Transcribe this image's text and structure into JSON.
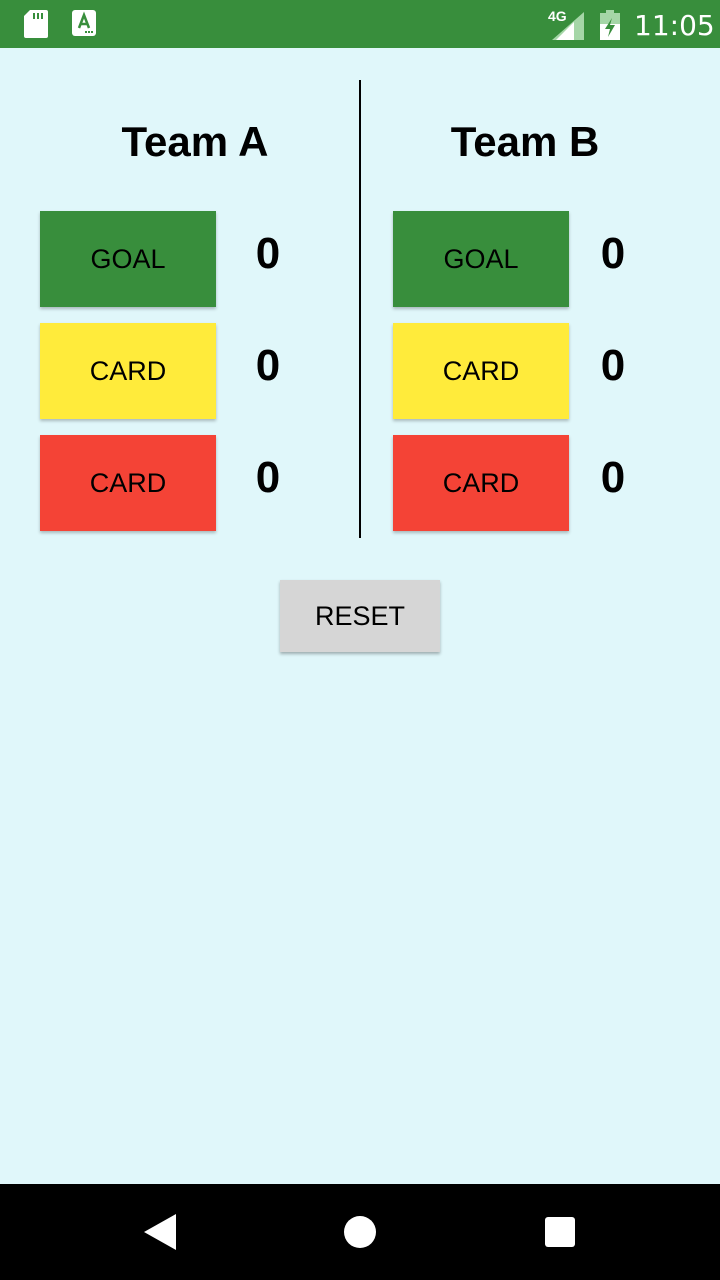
{
  "status_bar": {
    "network_label": "4G",
    "time": "11:05",
    "icons": [
      "sd-card-icon",
      "app-notification-icon",
      "signal-icon",
      "battery-charging-icon"
    ],
    "background_color": "#388e3c"
  },
  "teams": [
    {
      "name": "Team A",
      "goal_label": "GOAL",
      "goal_count": "0",
      "yellow_card_label": "CARD",
      "yellow_card_count": "0",
      "red_card_label": "CARD",
      "red_card_count": "0"
    },
    {
      "name": "Team B",
      "goal_label": "GOAL",
      "goal_count": "0",
      "yellow_card_label": "CARD",
      "yellow_card_count": "0",
      "red_card_label": "CARD",
      "red_card_count": "0"
    }
  ],
  "reset_label": "RESET",
  "colors": {
    "background": "#e0f7fa",
    "goal_button": "#388e3c",
    "yellow_card_button": "#ffeb3b",
    "red_card_button": "#f44336",
    "reset_button": "#d6d6d6"
  },
  "nav_bar": {
    "icons": [
      "back-icon",
      "home-icon",
      "recents-icon"
    ]
  }
}
